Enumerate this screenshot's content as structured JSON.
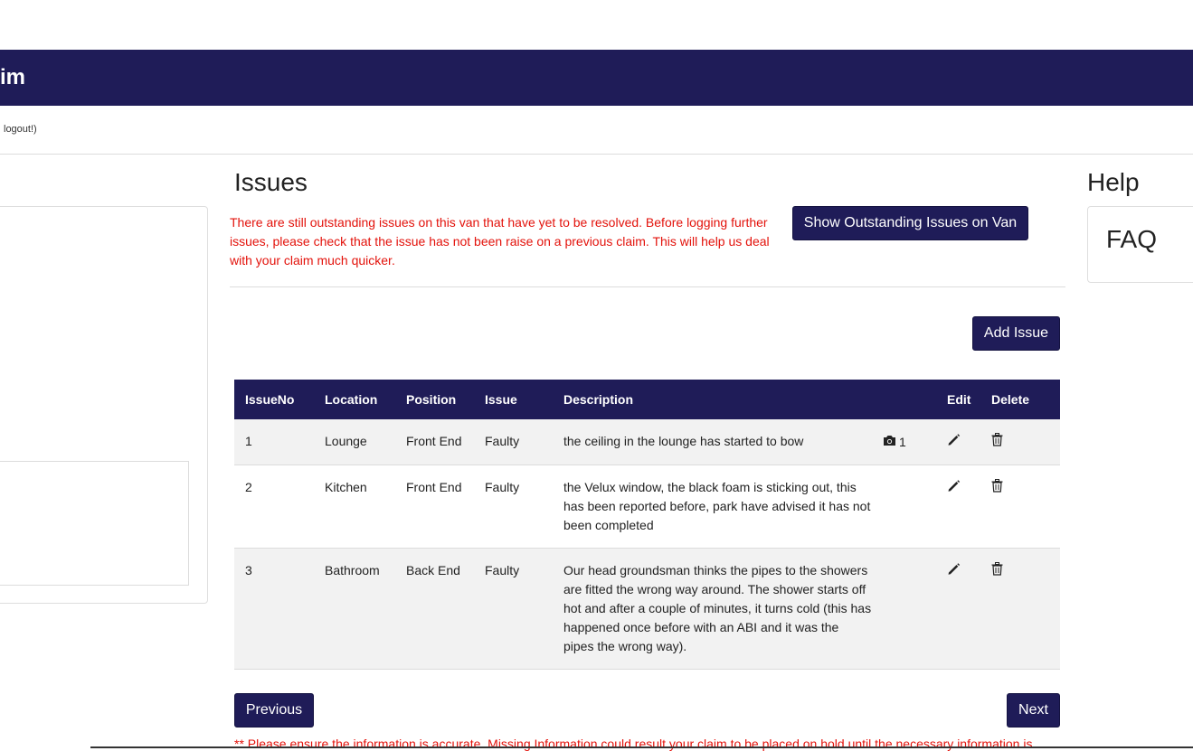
{
  "header": {
    "title": "im"
  },
  "userbar": {
    "text": " logout!)"
  },
  "issues": {
    "heading": "Issues",
    "warning": "There are still outstanding issues on this van that have yet to be resolved. Before logging further issues, please check that the issue has not been raise on a previous claim. This will help us deal with your claim much quicker.",
    "show_outstanding_label": "Show Outstanding Issues on Van",
    "add_issue_label": "Add Issue",
    "columns": {
      "issue_no": "IssueNo",
      "location": "Location",
      "position": "Position",
      "issue": "Issue",
      "description": "Description",
      "edit": "Edit",
      "delete": "Delete"
    },
    "rows": [
      {
        "issue_no": "1",
        "location": "Lounge",
        "position": "Front End",
        "issue": "Faulty",
        "description": "the ceiling in the lounge has started to bow",
        "photos": "1"
      },
      {
        "issue_no": "2",
        "location": "Kitchen",
        "position": "Front End",
        "issue": "Faulty",
        "description": "the Velux window, the black foam is sticking out, this has been reported before, park have advised it has not been completed",
        "photos": ""
      },
      {
        "issue_no": "3",
        "location": "Bathroom",
        "position": "Back End",
        "issue": "Faulty",
        "description": "Our head groundsman thinks the pipes to the showers are fitted the wrong way around. The shower starts off hot and after a couple of minutes, it turns cold (this has happened once before with an ABI and it was the pipes the wrong way).",
        "photos": ""
      }
    ],
    "icons": {
      "photo": "camera-icon",
      "edit": "pencil-icon",
      "delete": "trash-icon"
    }
  },
  "nav": {
    "previous_label": "Previous",
    "next_label": "Next"
  },
  "help": {
    "heading": "Help",
    "faq_label": "FAQ"
  },
  "footnote": "** Please ensure the information is accurate. Missing Information could result your claim to be placed on hold until the necessary information is",
  "colors": {
    "brand": "#1f1c58",
    "warning": "#e3120b",
    "row_alt": "#f2f2f2"
  }
}
